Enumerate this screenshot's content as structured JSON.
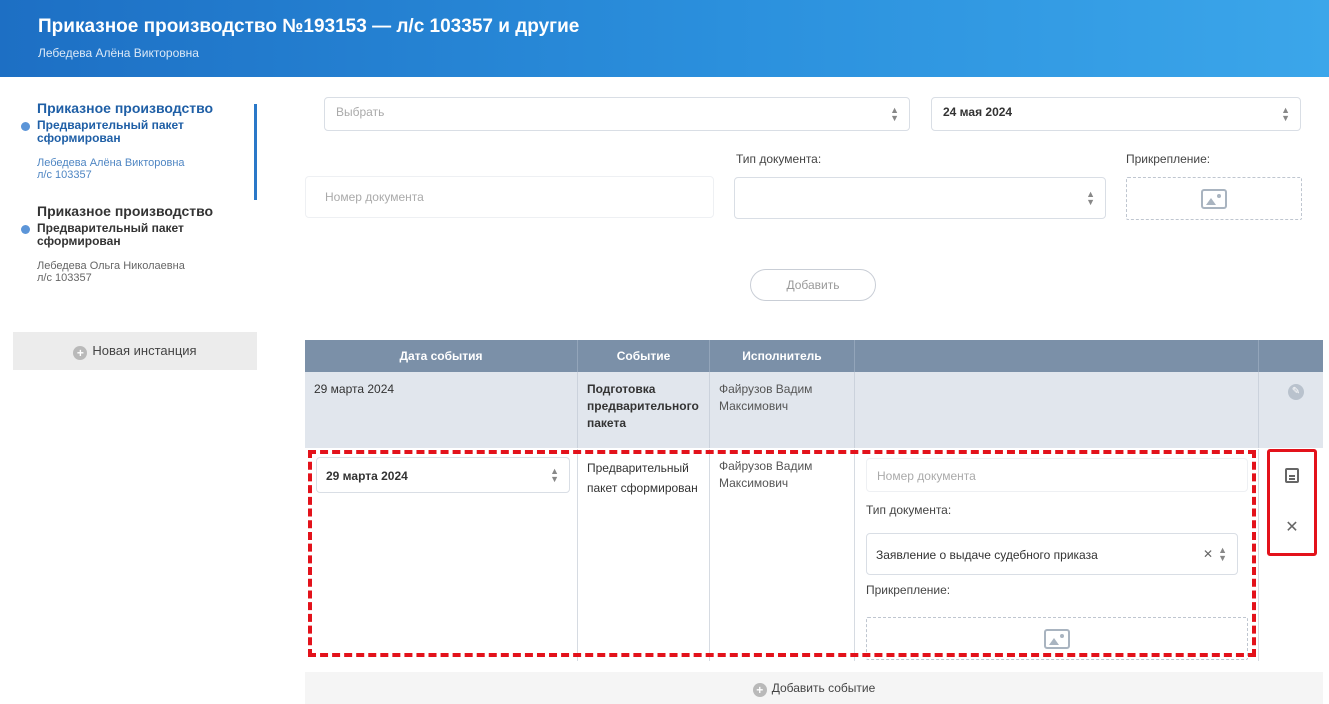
{
  "header": {
    "title": "Приказное производство №193153 — л/с 103357 и другие",
    "subtitle": "Лебедева Алёна Викторовна"
  },
  "sidebar": {
    "instances": [
      {
        "title": "Приказное производство",
        "status": "Предварительный пакет сформирован",
        "person": "Лебедева Алёна Викторовна",
        "account": "л/с 103357"
      },
      {
        "title": "Приказное производство",
        "status": "Предварительный пакет сформирован",
        "person": "Лебедева Ольга Николаевна",
        "account": "л/с 103357"
      }
    ],
    "new_instance": "Новая инстанция"
  },
  "form": {
    "select_placeholder": "Выбрать",
    "date_value": "24 мая 2024",
    "doc_number_placeholder": "Номер документа",
    "doc_type_label": "Тип документа:",
    "attachment_label": "Прикрепление:",
    "add_button": "Добавить"
  },
  "table": {
    "headers": [
      "Дата события",
      "Событие",
      "Исполнитель"
    ],
    "row1": {
      "date": "29 марта 2024",
      "event": "Подготовка предварительного пакета",
      "executor": "Файрузов Вадим Максимович"
    },
    "row2": {
      "date": "29 марта 2024",
      "event": "Предварительный пакет сформирован",
      "executor": "Файрузов Вадим Максимович",
      "doc_number_placeholder": "Номер документа",
      "doc_type_label": "Тип документа:",
      "doc_type_value": "Заявление о выдаче судебного приказа",
      "attachment_label": "Прикрепление:"
    }
  },
  "add_event": "Добавить событие",
  "colors": {
    "header_start": "#1d6fc4",
    "header_end": "#3ba6ea",
    "table_header": "#7b90a8",
    "highlight": "#e3121b"
  }
}
